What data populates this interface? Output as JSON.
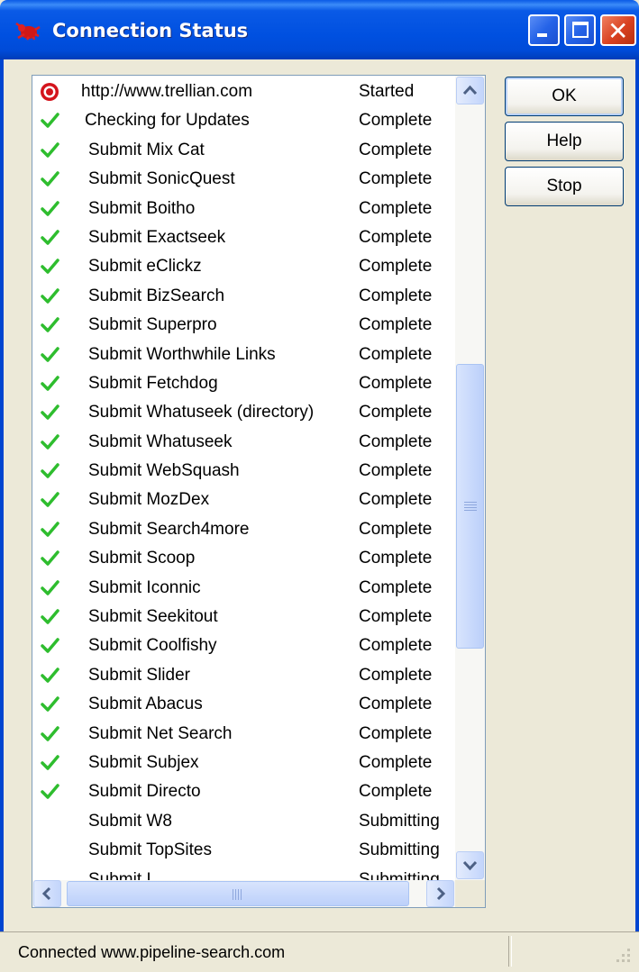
{
  "window": {
    "title": "Connection Status",
    "icon": "red-bug-logo-icon",
    "controls": {
      "minimize": "minimize-icon",
      "maximize": "maximize-icon",
      "close": "close-icon"
    }
  },
  "colors": {
    "title_bar": "#0054e3",
    "check": "#2ebd2e",
    "started_icon": "#d4141c",
    "panel": "#ece9d8"
  },
  "list": {
    "rows": [
      {
        "icon": "started-target-icon",
        "name": "http://www.trellian.com",
        "status": "Started"
      },
      {
        "icon": "check-icon",
        "name": "Checking for Updates",
        "status": "Complete"
      },
      {
        "icon": "check-icon",
        "name": "Submit Mix Cat",
        "status": "Complete"
      },
      {
        "icon": "check-icon",
        "name": "Submit SonicQuest",
        "status": "Complete"
      },
      {
        "icon": "check-icon",
        "name": "Submit Boitho",
        "status": "Complete"
      },
      {
        "icon": "check-icon",
        "name": "Submit Exactseek",
        "status": "Complete"
      },
      {
        "icon": "check-icon",
        "name": "Submit eClickz",
        "status": "Complete"
      },
      {
        "icon": "check-icon",
        "name": "Submit BizSearch",
        "status": "Complete"
      },
      {
        "icon": "check-icon",
        "name": "Submit Superpro",
        "status": "Complete"
      },
      {
        "icon": "check-icon",
        "name": "Submit Worthwhile Links",
        "status": "Complete"
      },
      {
        "icon": "check-icon",
        "name": "Submit Fetchdog",
        "status": "Complete"
      },
      {
        "icon": "check-icon",
        "name": "Submit Whatuseek (directory)",
        "status": "Complete"
      },
      {
        "icon": "check-icon",
        "name": "Submit Whatuseek",
        "status": "Complete"
      },
      {
        "icon": "check-icon",
        "name": "Submit WebSquash",
        "status": "Complete"
      },
      {
        "icon": "check-icon",
        "name": "Submit MozDex",
        "status": "Complete"
      },
      {
        "icon": "check-icon",
        "name": "Submit Search4more",
        "status": "Complete"
      },
      {
        "icon": "check-icon",
        "name": "Submit Scoop",
        "status": "Complete"
      },
      {
        "icon": "check-icon",
        "name": "Submit Iconnic",
        "status": "Complete"
      },
      {
        "icon": "check-icon",
        "name": "Submit Seekitout",
        "status": "Complete"
      },
      {
        "icon": "check-icon",
        "name": "Submit Coolfishy",
        "status": "Complete"
      },
      {
        "icon": "check-icon",
        "name": "Submit Slider",
        "status": "Complete"
      },
      {
        "icon": "check-icon",
        "name": "Submit Abacus",
        "status": "Complete"
      },
      {
        "icon": "check-icon",
        "name": "Submit Net Search",
        "status": "Complete"
      },
      {
        "icon": "check-icon",
        "name": "Submit Subjex",
        "status": "Complete"
      },
      {
        "icon": "check-icon",
        "name": "Submit Directo",
        "status": "Complete"
      },
      {
        "icon": "",
        "name": "Submit W8",
        "status": "Submitting"
      },
      {
        "icon": "",
        "name": "Submit TopSites",
        "status": "Submitting"
      },
      {
        "icon": "",
        "name": "Submit I...",
        "status": "Submitting"
      }
    ],
    "scrollbar": {
      "up": "scroll-up-arrow-icon",
      "down": "scroll-down-arrow-icon",
      "left": "scroll-left-arrow-icon",
      "right": "scroll-right-arrow-icon"
    }
  },
  "buttons": {
    "ok": "OK",
    "help": "Help",
    "stop": "Stop"
  },
  "statusbar": {
    "text": "Connected www.pipeline-search.com"
  }
}
